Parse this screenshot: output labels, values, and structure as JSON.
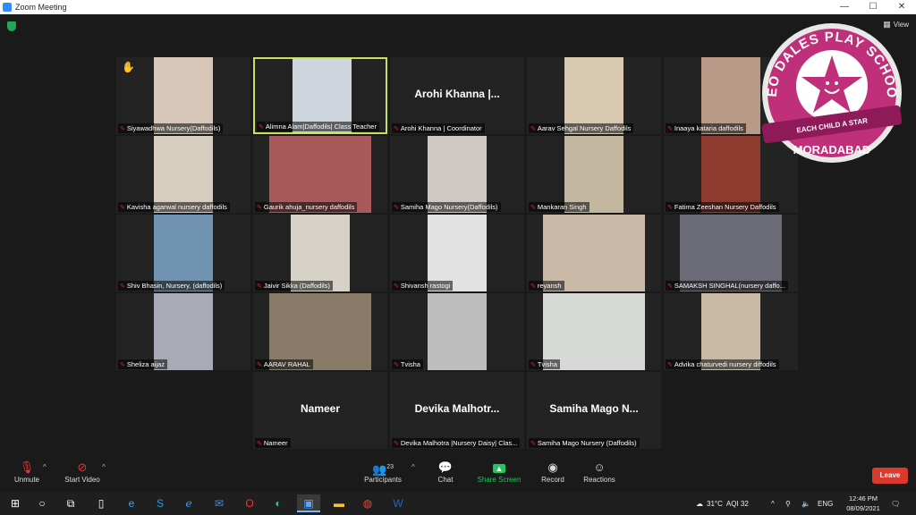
{
  "window": {
    "title": "Zoom Meeting",
    "controls": [
      "—",
      "☐",
      "✕"
    ]
  },
  "view_label": "View",
  "tiles": [
    {
      "label": "Siyawadhwa Nursery(Daffodils)",
      "muted": true,
      "video": "#d8c7b8",
      "hand": true
    },
    {
      "label": "Alimna Alam|Daffodils| Class Teacher",
      "muted": true,
      "video": "#cfd5dc",
      "active": true
    },
    {
      "label": "Arohi Khanna | Coordinator",
      "muted": true,
      "name_display": "Arohi Khanna |..."
    },
    {
      "label": "Aarav Sehgal Nursery Daffodils",
      "muted": true,
      "video": "#d9c9b0"
    },
    {
      "label": "Inaaya kataria daffodils",
      "muted": true,
      "video": "#b89a86"
    },
    {
      "label": "Kavisha agarwal nursery daffodils",
      "muted": true,
      "video": "#d7cdbf"
    },
    {
      "label": "Gaurik ahuja_nursery daffodils",
      "muted": true,
      "video": "#a85a5a"
    },
    {
      "label": "Samiha Mago Nursery(Daffodils)",
      "muted": true,
      "video": "#cfc7c2"
    },
    {
      "label": "Mankaran Singh",
      "muted": true,
      "video": "#c4b79f"
    },
    {
      "label": "Fatima Zeeshan Nursery Daffodils",
      "muted": true,
      "video": "#8e3a2f"
    },
    {
      "label": "Shiv Bhasin, Nursery, (daffodils)",
      "muted": true,
      "video": "#6f93b0"
    },
    {
      "label": "Jaivir Sikka (Daffodils)",
      "muted": true,
      "video": "#d6d2c8"
    },
    {
      "label": "Shivansh rastogi",
      "muted": true,
      "video": "#e2e2e2"
    },
    {
      "label": "reyansh",
      "muted": true,
      "video": "#c9b9a6"
    },
    {
      "label": "SAMAKSH SINGHAL(nursery daffo...",
      "muted": true,
      "video": "#6b6b78"
    },
    {
      "label": "Sheliza aijaz",
      "muted": true,
      "video": "#a8aab6"
    },
    {
      "label": "AARAV RAHAL",
      "muted": true,
      "video": "#8a7a68"
    },
    {
      "label": "Tvisha",
      "muted": true,
      "video": "#bdbdbd"
    },
    {
      "label": "Tvisha",
      "muted": true,
      "video": "#d7d9d6"
    },
    {
      "label": "Advika chaturvedi nursery diffodils",
      "muted": true,
      "video": "#c8b8a4"
    },
    {
      "label": "Nameer",
      "muted": true,
      "name_display": "Nameer"
    },
    {
      "label": "Devika Malhotra |Nursery Daisy| Clas...",
      "muted": true,
      "name_display": "Devika Malhotr..."
    },
    {
      "label": "Samiha Mago Nursery (Daffodils)",
      "muted": true,
      "name_display": "Samiha Mago N..."
    }
  ],
  "logo": {
    "arc_text": "NEO DALES PLAY SCHOOL",
    "tagline": "EACH CHILD A STAR",
    "city": "MORADABAD",
    "color_primary": "#c0307a",
    "color_dark": "#8e1a5a"
  },
  "toolbar": {
    "unmute": "Unmute",
    "start_video": "Start Video",
    "participants": "Participants",
    "participant_count": "23",
    "chat": "Chat",
    "share_screen": "Share Screen",
    "record": "Record",
    "reactions": "Reactions",
    "leave": "Leave"
  },
  "taskbar": {
    "weather": "31°C",
    "aqi": "AQI 32",
    "time": "12:46 PM",
    "date": "08/09/2021",
    "apps": [
      "windows-icon",
      "search-icon",
      "task-view-icon",
      "file-icon",
      "edge-icon",
      "skype-icon",
      "ie-icon",
      "mail-icon",
      "opera-icon",
      "edge-new-icon",
      "zoom-icon",
      "explorer-icon",
      "chrome-icon",
      "word-icon"
    ]
  },
  "colors": {
    "active_border": "#c6e15a",
    "leave": "#d93a2d",
    "share_green": "#23c55e"
  }
}
